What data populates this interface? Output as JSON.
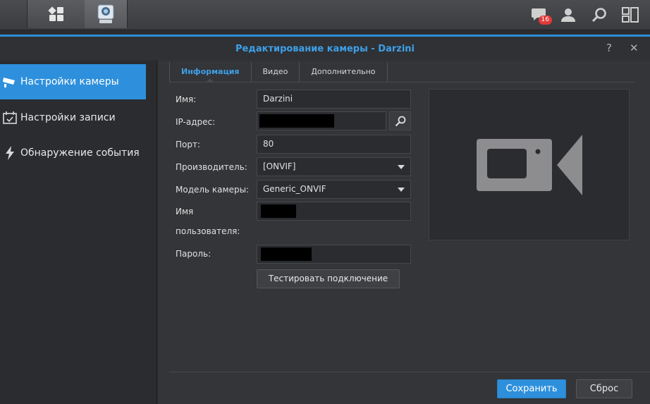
{
  "taskbar": {
    "notification_count": "16"
  },
  "window": {
    "title": "Редактирование камеры - Darzini",
    "help_glyph": "?",
    "close_glyph": "✕"
  },
  "sidebar": {
    "items": [
      {
        "label": "Настройки камеры",
        "icon": "camera-settings-icon",
        "active": true
      },
      {
        "label": "Настройки записи",
        "icon": "calendar-icon",
        "active": false
      },
      {
        "label": "Обнаружение события",
        "icon": "lightning-icon",
        "active": false
      }
    ]
  },
  "tabs": [
    {
      "label": "Информация",
      "active": true
    },
    {
      "label": "Видео",
      "active": false
    },
    {
      "label": "Дополнительно",
      "active": false
    }
  ],
  "form": {
    "name_label": "Имя:",
    "name_value": "Darzini",
    "ip_label": "IP-адрес:",
    "port_label": "Порт:",
    "port_value": "80",
    "vendor_label": "Производитель:",
    "vendor_value": "[ONVIF]",
    "model_label": "Модель камеры:",
    "model_value": "Generic_ONVIF",
    "username_label_line1": "Имя",
    "username_label_line2": "пользователя:",
    "password_label": "Пароль:",
    "test_button": "Тестировать подключение"
  },
  "footer": {
    "save_label": "Сохранить",
    "reset_label": "Сброс"
  },
  "colors": {
    "accent": "#2e90dc",
    "title": "#3ea0e8",
    "badge": "#e23a3a"
  }
}
